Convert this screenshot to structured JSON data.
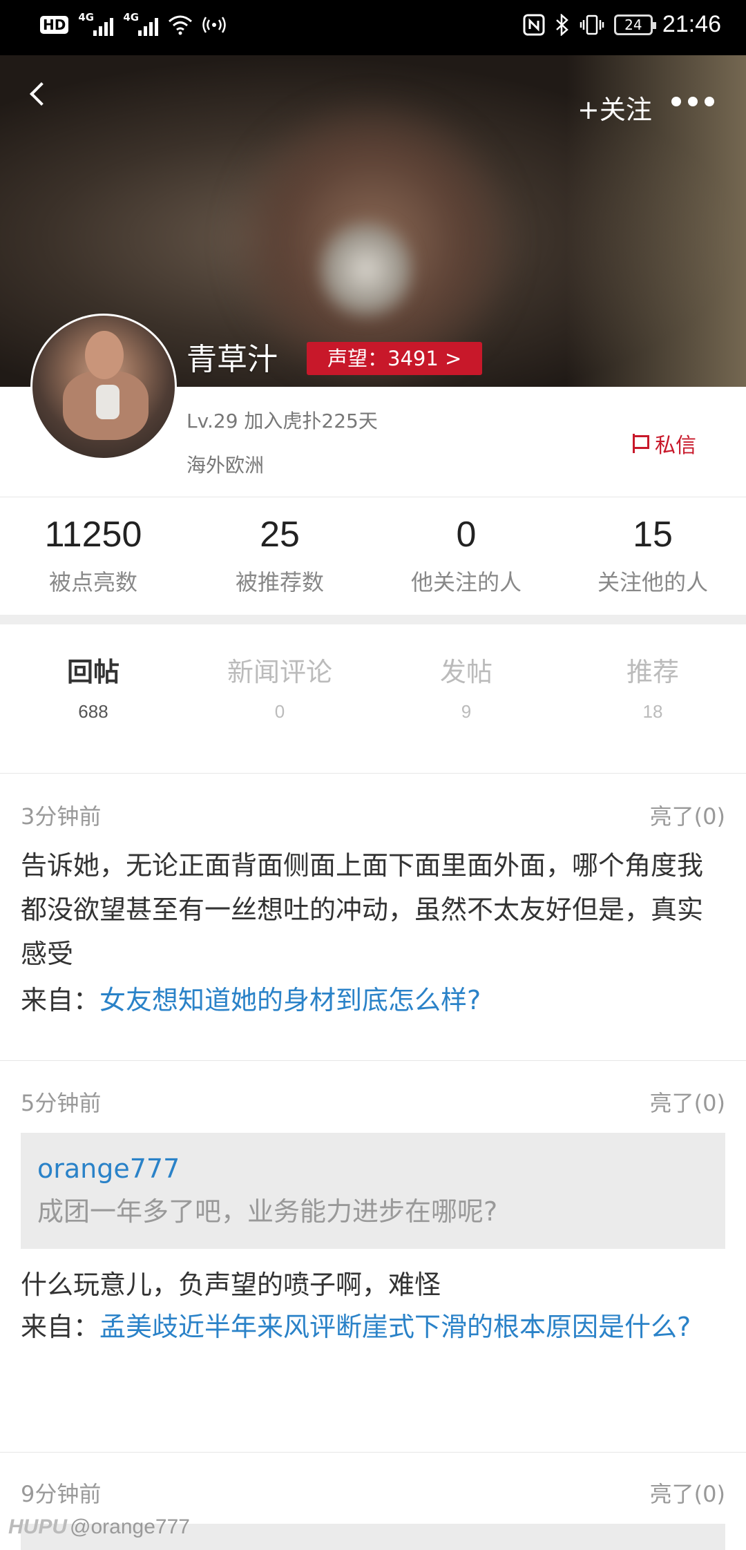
{
  "status_bar": {
    "hd": "HD",
    "net1": "4G",
    "net2": "4G",
    "battery": "24",
    "time": "21:46"
  },
  "header": {
    "follow_label": "+关注"
  },
  "profile": {
    "name": "青草汁",
    "reputation": "声望：3491 >",
    "level_join": "Lv.29  加入虎扑225天",
    "region": "海外欧洲",
    "dm_label": "私信"
  },
  "stats": [
    {
      "value": "11250",
      "label": "被点亮数"
    },
    {
      "value": "25",
      "label": "被推荐数"
    },
    {
      "value": "0",
      "label": "他关注的人"
    },
    {
      "value": "15",
      "label": "关注他的人"
    }
  ],
  "tabs": [
    {
      "label": "回帖",
      "count": "688"
    },
    {
      "label": "新闻评论",
      "count": "0"
    },
    {
      "label": "发帖",
      "count": "9"
    },
    {
      "label": "推荐",
      "count": "18"
    }
  ],
  "posts": [
    {
      "time": "3分钟前",
      "likes": "亮了(0)",
      "text": "告诉她，无论正面背面侧面上面下面里面外面，哪个角度我都没欲望甚至有一丝想吐的冲动，虽然不太友好但是，真实感受",
      "from_label": "来自：",
      "from_title": "女友想知道她的身材到底怎么样?"
    },
    {
      "time": "5分钟前",
      "likes": "亮了(0)",
      "quote_user": "orange777",
      "quote_text": "成团一年多了吧，业务能力进步在哪呢?",
      "text": "什么玩意儿，负声望的喷子啊，难怪",
      "from_label": "来自：",
      "from_title": "孟美歧近半年来风评断崖式下滑的根本原因是什么?"
    },
    {
      "time": "9分钟前",
      "likes": "亮了(0)"
    }
  ],
  "watermark": {
    "brand": "HUPU",
    "user": "@orange777"
  }
}
